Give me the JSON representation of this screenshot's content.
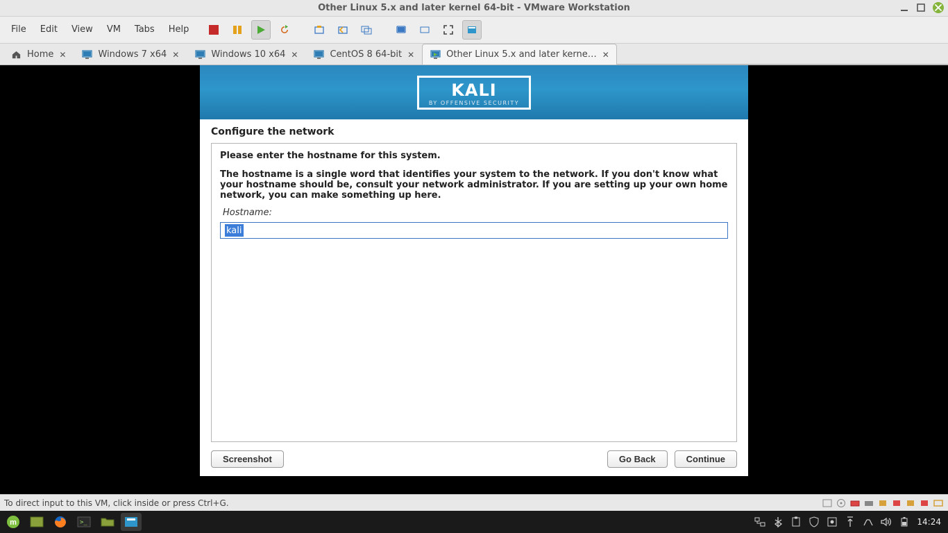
{
  "window": {
    "title": "Other Linux 5.x and later kernel 64-bit - VMware Workstation"
  },
  "menu": {
    "file": "File",
    "edit": "Edit",
    "view": "View",
    "vm": "VM",
    "tabs": "Tabs",
    "help": "Help"
  },
  "tabs": {
    "items": [
      {
        "label": "Home"
      },
      {
        "label": "Windows 7 x64"
      },
      {
        "label": "Windows 10 x64"
      },
      {
        "label": "CentOS 8 64-bit"
      },
      {
        "label": "Other Linux 5.x and later kerne…"
      }
    ]
  },
  "installer": {
    "banner_title": "KALI",
    "banner_sub": "BY OFFENSIVE SECURITY",
    "section_title": "Configure the network",
    "lead": "Please enter the hostname for this system.",
    "para": "The hostname is a single word that identifies your system to the network. If you don't know what your hostname should be, consult your network administrator. If you are setting up your own home network, you can make something up here.",
    "field_label": "Hostname:",
    "hostname_value": "kali",
    "btn_screenshot": "Screenshot",
    "btn_goback": "Go Back",
    "btn_continue": "Continue"
  },
  "statusbar": {
    "hint": "To direct input to this VM, click inside or press Ctrl+G."
  },
  "panel": {
    "clock": "14:24"
  }
}
